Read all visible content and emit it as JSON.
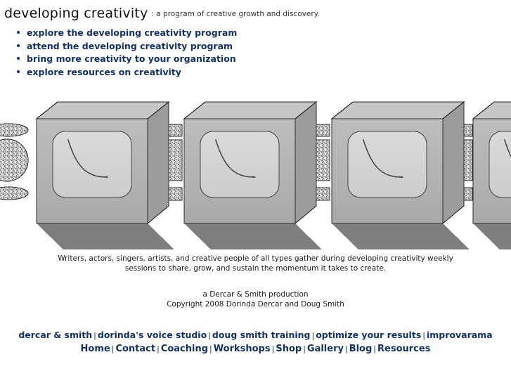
{
  "header": {
    "title": "developing creativity",
    "tagline": ": a program of creative growth and discovery."
  },
  "nav": {
    "items": [
      {
        "label": "explore the developing creativity program"
      },
      {
        "label": "attend the developing creativity program"
      },
      {
        "label": "bring more creativity to your organization"
      },
      {
        "label": "explore resources on creativity"
      }
    ]
  },
  "banner": {
    "alt": "row of stylized gray television boxes with smiling screens and speckled panels casting shadows",
    "icons": {
      "box": "tv-box-icon",
      "screen": "screen-smile-icon",
      "panel": "speckled-panel-icon",
      "shadow": "floor-shadow-icon"
    },
    "colors": {
      "box_front": "#b2b2b2",
      "box_top": "#c8c8c8",
      "box_side": "#9a9a9a",
      "screen": "#d4d4d4",
      "shadow": "#7e7e7e",
      "outline": "#2b2b2b",
      "speckle_base": "#c9c9c9"
    }
  },
  "caption": {
    "lines": [
      "Writers, actors, singers, artists, and creative people of all types gather during developing creativity weekly",
      "sessions to share, grow, and sustain the momentum it takes to create."
    ]
  },
  "credits": {
    "lines": [
      "a Dercar & Smith production",
      "Copyright 2008 Dorinda Dercar and Doug Smith"
    ]
  },
  "footer": {
    "separator": "|",
    "partners": [
      {
        "label": "dercar & smith"
      },
      {
        "label": "dorinda's voice studio"
      },
      {
        "label": "doug smith training"
      },
      {
        "label": "optimize your results"
      },
      {
        "label": "improvarama"
      }
    ],
    "pages": [
      {
        "label": "Home"
      },
      {
        "label": "Contact"
      },
      {
        "label": "Coaching"
      },
      {
        "label": "Workshops"
      },
      {
        "label": "Shop"
      },
      {
        "label": "Gallery"
      },
      {
        "label": "Blog"
      },
      {
        "label": "Resources"
      }
    ]
  },
  "colors": {
    "link": "#14305e",
    "text": "#1a1a1a",
    "background": "#ffffff"
  }
}
